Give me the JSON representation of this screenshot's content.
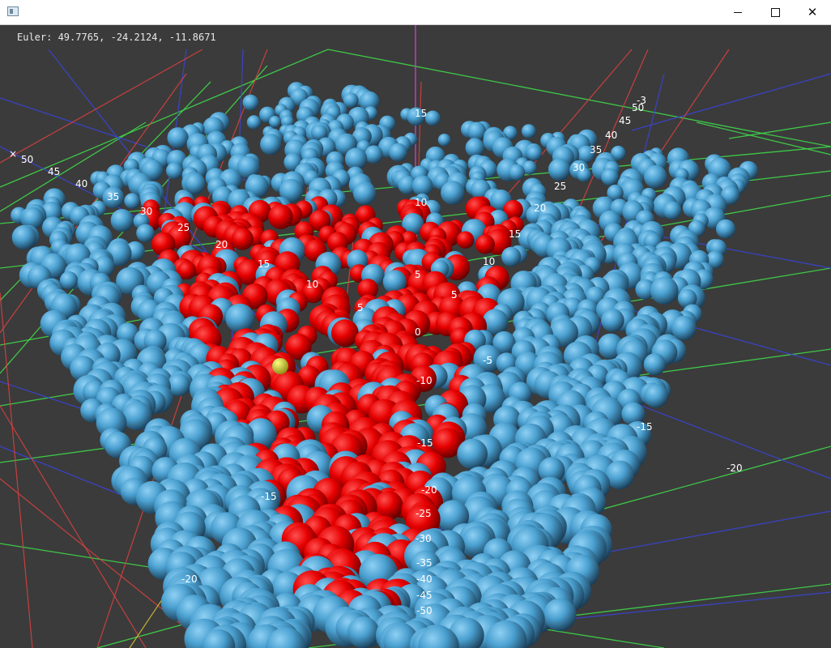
{
  "window": {
    "minimize_glyph": "minimize-icon",
    "maximize_glyph": "maximize-icon",
    "close_glyph": "✕"
  },
  "viewer": {
    "euler_label": "Euler: 49.7765, -24.2124, -11.8671",
    "euler": [
      49.7765,
      -24.2124,
      -11.8671
    ],
    "background": "#3b3b3b",
    "grid_colors": {
      "green": "#3fe04a",
      "blue": "#3a44d8",
      "red": "#e04040",
      "magenta": "#d040d0",
      "yellow": "#d8c830"
    },
    "sphere_colors": {
      "blue": "#4aa0d0",
      "red": "#e60000",
      "highlight": "#d8d820"
    },
    "x_axis_marker": "×",
    "tick_labels": {
      "left_diagonal": [
        "50",
        "45",
        "40",
        "35",
        "30",
        "25",
        "20",
        "15",
        "10",
        "5"
      ],
      "center_vertical": [
        "15",
        "10",
        "5",
        "0",
        "-5",
        "5",
        "-10",
        "-15",
        "-20",
        "-25",
        "-30",
        "-35",
        "-40",
        "-45",
        "-50"
      ],
      "right_diagonal": [
        "-3",
        "50",
        "45",
        "40",
        "35",
        "30",
        "25",
        "20",
        "15",
        "10",
        "5",
        "-5"
      ],
      "edge_values": [
        "-15",
        "-20",
        "-15",
        "-20"
      ]
    }
  }
}
